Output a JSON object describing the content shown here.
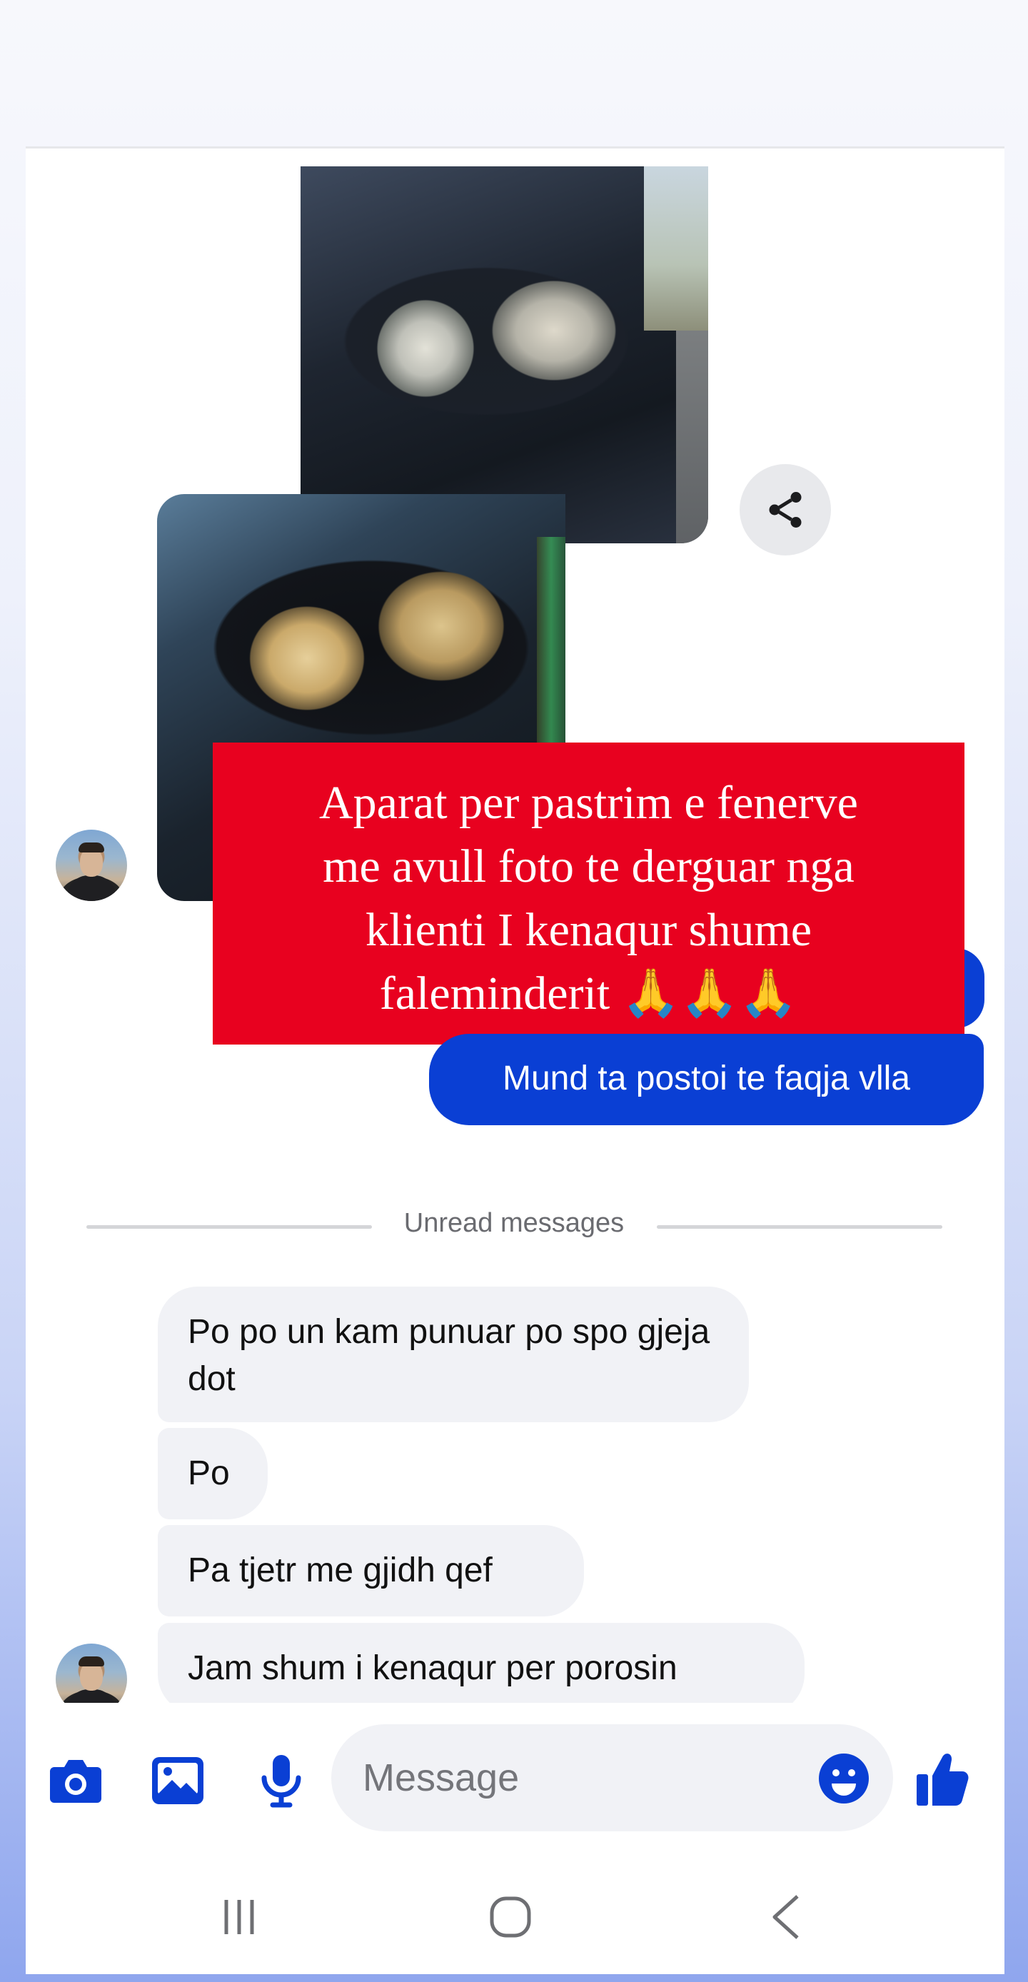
{
  "conversation": {
    "overlay_banner": {
      "lines": [
        "Aparat per pastrim e fenerve",
        "me avull foto te derguar nga",
        "klienti I kenaqur shume",
        "faleminderit 🙏🙏🙏"
      ]
    },
    "outgoing": [
      {
        "text": "Mund ta postoi te faqja vlla"
      }
    ],
    "divider": {
      "label": "Unread messages"
    },
    "incoming": [
      {
        "text": "Po  po un kam punuar po spo gjeja dot"
      },
      {
        "text": "Po"
      },
      {
        "text": "Pa tjetr me gjidh qef"
      },
      {
        "text": "Jam shum i kenaqur per porosin"
      }
    ]
  },
  "composer": {
    "placeholder": "Message",
    "accent_color": "#0a3fd4",
    "icons": [
      "camera-icon",
      "image-icon",
      "microphone-icon",
      "emoji-icon",
      "thumbs-up-icon"
    ]
  },
  "colors": {
    "outgoing_bubble": "#0a3fd4",
    "incoming_bubble": "#f1f2f6",
    "banner": "#e8011f"
  }
}
